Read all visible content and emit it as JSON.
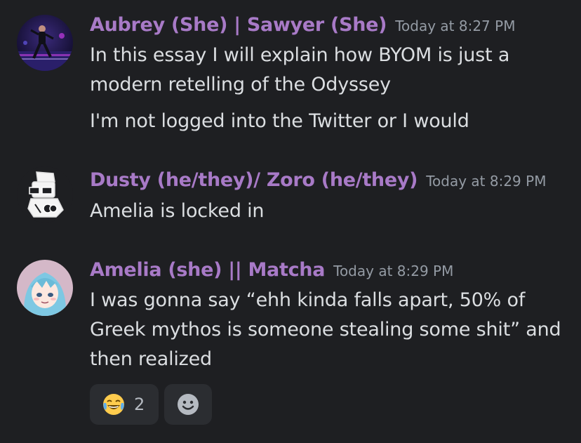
{
  "colors": {
    "background": "#1e1f22",
    "username": "#a87ac7",
    "text": "#dbdee1",
    "timestamp": "#949ba4",
    "reaction_bg": "#2b2d31"
  },
  "messages": [
    {
      "author": "Aubrey (She) | Sawyer (She)",
      "timestamp": "Today at 8:27 PM",
      "avatar_icon": "photo-avatar-performer",
      "lines": [
        "In this essay I will explain how BYOM is just a",
        "modern retelling of the Odyssey",
        "I'm not logged into the Twitter or I would"
      ]
    },
    {
      "author": "Dusty (he/they)/ Zoro (he/they)",
      "timestamp": "Today at 8:29 PM",
      "avatar_icon": "sketch-avatar",
      "lines": [
        "Amelia is locked in"
      ]
    },
    {
      "author": "Amelia (she) || Matcha",
      "timestamp": "Today at 8:29 PM",
      "avatar_icon": "anime-girl-avatar",
      "lines": [
        "I was gonna say “ehh kinda falls apart, 50% of",
        "Greek mythos is someone stealing some shit” and",
        "then realized"
      ]
    }
  ],
  "reactions": [
    {
      "emoji_icon": "joy-emoji-icon",
      "count": "2"
    }
  ],
  "add_reaction_icon": "smiley-add-reaction-icon"
}
